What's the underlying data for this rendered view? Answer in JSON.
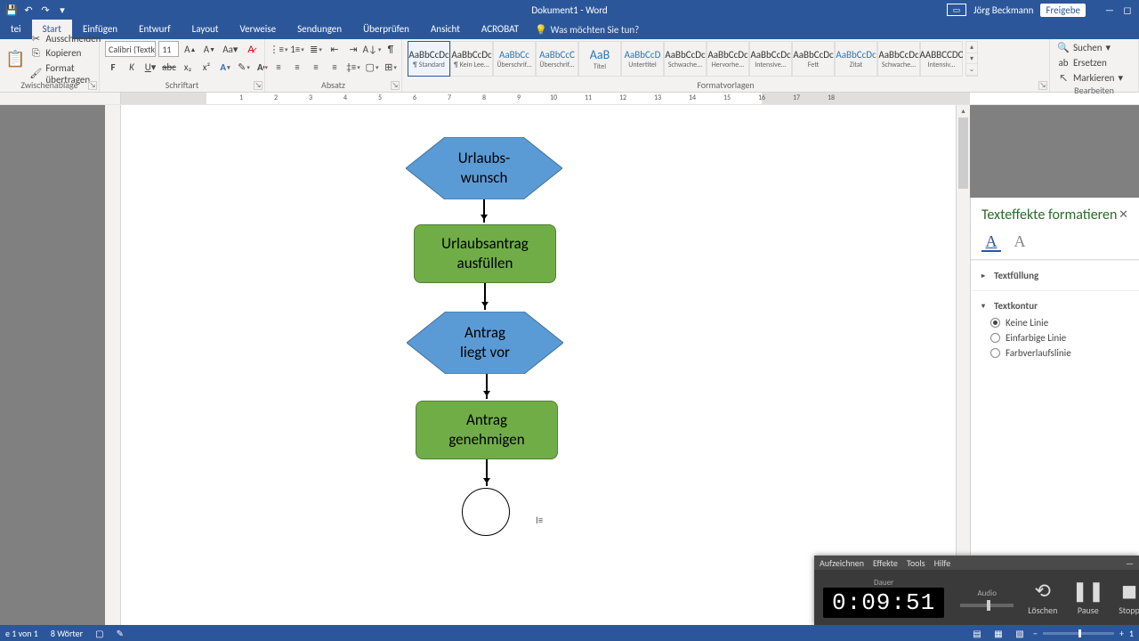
{
  "titlebar": {
    "title": "Dokument1 - Word",
    "user": "Jörg Beckmann",
    "share": "Freigebe"
  },
  "tabs": {
    "file": "tei",
    "start": "Start",
    "einfuegen": "Einfügen",
    "entwurf": "Entwurf",
    "layout": "Layout",
    "verweise": "Verweise",
    "sendungen": "Sendungen",
    "ueberpruefen": "Überprüfen",
    "ansicht": "Ansicht",
    "acrobat": "ACROBAT",
    "tellme": "Was möchten Sie tun?"
  },
  "clipboard": {
    "paste": "Einfügen",
    "cut": "Ausschneiden",
    "copy": "Kopieren",
    "format_painter": "Format übertragen",
    "group": "Zwischenablage"
  },
  "font": {
    "name": "Calibri (Textk",
    "size": "11",
    "group": "Schriftart"
  },
  "paragraph": {
    "group": "Absatz"
  },
  "styles": {
    "group": "Formatvorlagen",
    "items": [
      {
        "sample": "AaBbCcDc",
        "label": "¶ Standard",
        "cls": ""
      },
      {
        "sample": "AaBbCcDc",
        "label": "¶ Kein Lee...",
        "cls": ""
      },
      {
        "sample": "AaBbCc",
        "label": "Überschrif...",
        "cls": "blue"
      },
      {
        "sample": "AaBbCcC",
        "label": "Überschrif...",
        "cls": "blue"
      },
      {
        "sample": "AaB",
        "label": "Titel",
        "cls": "big"
      },
      {
        "sample": "AaBbCcD",
        "label": "Untertitel",
        "cls": "blue"
      },
      {
        "sample": "AaBbCcDc",
        "label": "Schwache...",
        "cls": ""
      },
      {
        "sample": "AaBbCcDc",
        "label": "Hervorhe...",
        "cls": ""
      },
      {
        "sample": "AaBbCcDc",
        "label": "Intensive...",
        "cls": ""
      },
      {
        "sample": "AaBbCcDc",
        "label": "Fett",
        "cls": ""
      },
      {
        "sample": "AaBbCcDc",
        "label": "Zitat",
        "cls": "blue"
      },
      {
        "sample": "AaBbCcDc",
        "label": "Schwache...",
        "cls": ""
      },
      {
        "sample": "AABBCCDC",
        "label": "Intensiv...",
        "cls": ""
      }
    ]
  },
  "editing": {
    "find": "Suchen",
    "replace": "Ersetzen",
    "select": "Markieren",
    "group": "Bearbeiten"
  },
  "flowchart": {
    "n1": "Urlaubs-\nwunsch",
    "n2": "Urlaubsantrag\nausfüllen",
    "n3": "Antrag\nliegt vor",
    "n4": "Antrag\ngenehmigen"
  },
  "pane": {
    "title": "Texteffekte formatieren",
    "sec_fill": "Textfüllung",
    "sec_outline": "Textkontur",
    "no_line": "Keine Linie",
    "solid_line": "Einfarbige Linie",
    "gradient_line": "Farbverlaufslinie"
  },
  "recorder": {
    "menu": [
      "Aufzeichnen",
      "Effekte",
      "Tools",
      "Hilfe"
    ],
    "duration_label": "Dauer",
    "time": "0:09:51",
    "audio_label": "Audio",
    "delete": "Löschen",
    "pause": "Pause",
    "stop": "Stopp"
  },
  "status": {
    "page": "e 1 von 1",
    "words": "8 Wörter",
    "zoom": "1"
  },
  "ruler_numbers": [
    1,
    2,
    3,
    4,
    5,
    6,
    7,
    8,
    9,
    10,
    11,
    12,
    13,
    14,
    15,
    16,
    17,
    18
  ]
}
